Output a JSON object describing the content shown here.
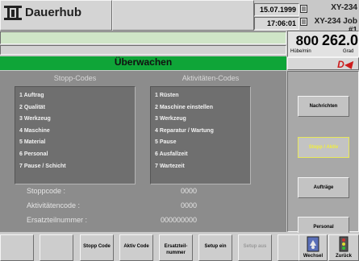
{
  "header": {
    "title": "Dauerhub",
    "date": "15.07.1999",
    "time": "17:06:01",
    "machine": "XY-234",
    "job": "XY-234 Job #1"
  },
  "rate": {
    "value": "800",
    "unit": "Hübe/min"
  },
  "angle": {
    "value": "262.0",
    "unit": "Grad"
  },
  "mode": {
    "label": "Überwachen",
    "color": "#0fa538"
  },
  "stopp_codes": {
    "title": "Stopp-Codes",
    "items": [
      "1 Auftrag",
      "2 Qualität",
      "3 Werkzeug",
      "4 Maschine",
      "5 Material",
      "6 Personal",
      "7 Pause / Schicht"
    ]
  },
  "aktivitaeten_codes": {
    "title": "Aktivitäten-Codes",
    "items": [
      "1 Rüsten",
      "2 Maschine einstellen",
      "3 Werkzeug",
      "4 Reparatur / Wartung",
      "5 Pause",
      "6 Ausfallzeit",
      "7 Wartezeit"
    ]
  },
  "fields": {
    "stoppcode_label": "Stoppcode :",
    "stoppcode_value": "0000",
    "aktivitaetencode_label": "Aktivitätencode :",
    "aktivitaetencode_value": "0000",
    "ersatzteilnummer_label": "Ersatzteilnummer :",
    "ersatzteilnummer_value": "000000000"
  },
  "side_buttons": {
    "nachrichten": "Nachrichten",
    "stopp_aktiv": "Stopp / Aktiv",
    "auftraege": "Aufträge",
    "personal": "Personal"
  },
  "footer": {
    "stopp_code": "Stopp Code",
    "aktiv_code": "Aktiv Code",
    "ersatzteilnummer": "Ersatzteil-nummer",
    "setup_ein": "Setup ein",
    "setup_aus": "Setup aus",
    "wechsel": "Wechsel",
    "zurueck": "Zurück"
  }
}
